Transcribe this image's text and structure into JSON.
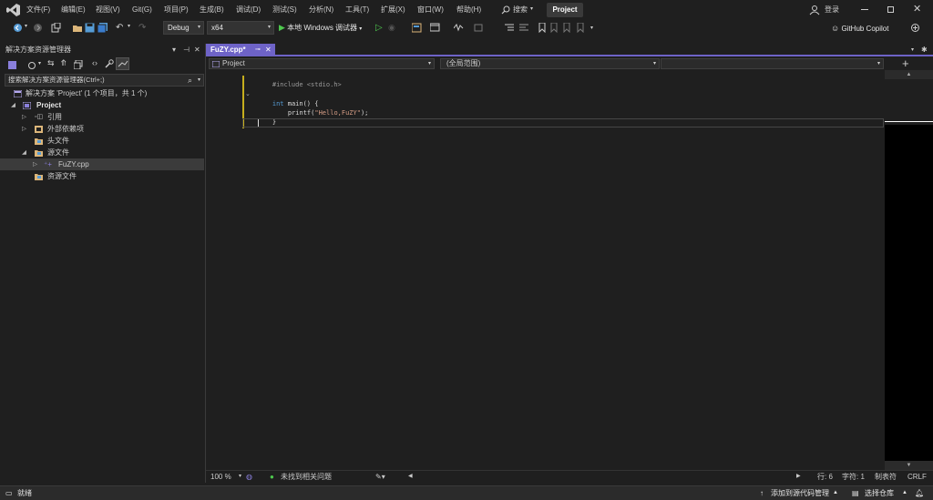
{
  "menu": {
    "items": [
      "文件(F)",
      "编辑(E)",
      "视图(V)",
      "Git(G)",
      "项目(P)",
      "生成(B)",
      "调试(D)",
      "测试(S)",
      "分析(N)",
      "工具(T)",
      "扩展(X)",
      "窗口(W)",
      "帮助(H)"
    ],
    "search_label": "搜索",
    "project_name": "Project",
    "login_label": "登录"
  },
  "toolbar": {
    "config": "Debug",
    "platform": "x64",
    "run_label": "本地 Windows 调试器",
    "copilot_label": "GitHub Copilot"
  },
  "solution_explorer": {
    "title": "解决方案资源管理器",
    "search_placeholder": "搜索解决方案资源管理器(Ctrl+;)",
    "items": [
      {
        "label": "解决方案 'Project' (1 个项目，共 1 个)"
      },
      {
        "label": "Project"
      },
      {
        "label": "引用"
      },
      {
        "label": "外部依赖项"
      },
      {
        "label": "头文件"
      },
      {
        "label": "源文件"
      },
      {
        "label": "FuZY.cpp"
      },
      {
        "label": "资源文件"
      }
    ]
  },
  "editor": {
    "tab_title": "FuZY.cpp*",
    "nav_project": "Project",
    "nav_scope": "(全局范围)",
    "code": {
      "include_directive": "#include",
      "include_header": "<stdio.h>",
      "kw_int": "int",
      "main_sig": "main() {",
      "printf_fn": "printf(",
      "printf_str": "\"Hello,FuZY\"",
      "printf_end": ");",
      "close_brace": "}"
    }
  },
  "editor_status": {
    "zoom": "100 %",
    "issues": "未找到相关问题",
    "row": "行: 6",
    "col": "字符: 1",
    "tabs": "制表符",
    "eol": "CRLF"
  },
  "statusbar": {
    "ready": "就绪",
    "add_source_control": "添加到源代码管理",
    "select_repo": "选择仓库"
  },
  "colors": {
    "accent": "#6e63c7",
    "keyword": "#569cd6",
    "string": "#d69d85",
    "preprocessor": "#9b9b9b",
    "run_green": "#4ec94e",
    "modified_bar": "#c6ae1d"
  }
}
